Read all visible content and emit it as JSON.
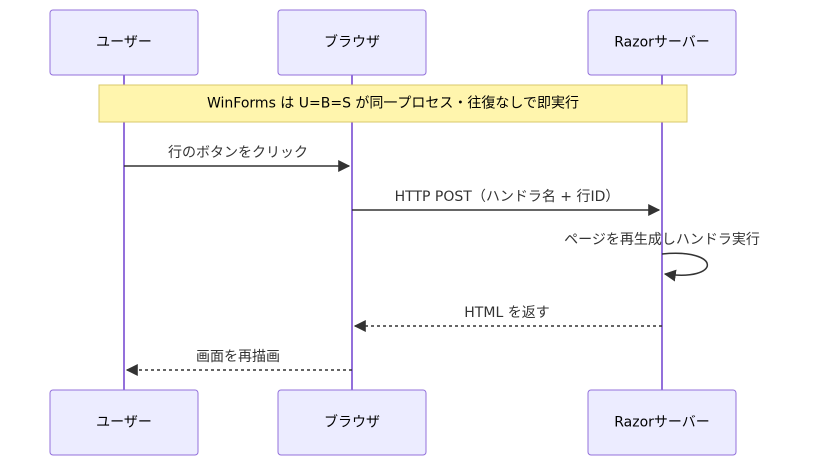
{
  "participants": [
    {
      "id": "user",
      "label": "ユーザー"
    },
    {
      "id": "browser",
      "label": "ブラウザ"
    },
    {
      "id": "server",
      "label": "Razorサーバー"
    }
  ],
  "note": {
    "text": "WinForms は U=B=S が同一プロセス・往復なしで即実行"
  },
  "messages": [
    {
      "from": "user",
      "to": "browser",
      "text": "行のボタンをクリック",
      "style": "solid"
    },
    {
      "from": "browser",
      "to": "server",
      "text": "HTTP POST（ハンドラ名 + 行ID）",
      "style": "solid"
    },
    {
      "from": "server",
      "to": "server",
      "text": "ページを再生成しハンドラ実行",
      "style": "solid"
    },
    {
      "from": "server",
      "to": "browser",
      "text": "HTML を返す",
      "style": "dashed"
    },
    {
      "from": "browser",
      "to": "user",
      "text": "画面を再描画",
      "style": "dashed"
    }
  ],
  "colors": {
    "actor_fill": "#ECECFF",
    "actor_stroke": "#9370DB",
    "lifeline": "#9370DB",
    "note_fill": "#FFF5AD",
    "note_stroke": "#D8C96A",
    "arrow": "#333333"
  }
}
